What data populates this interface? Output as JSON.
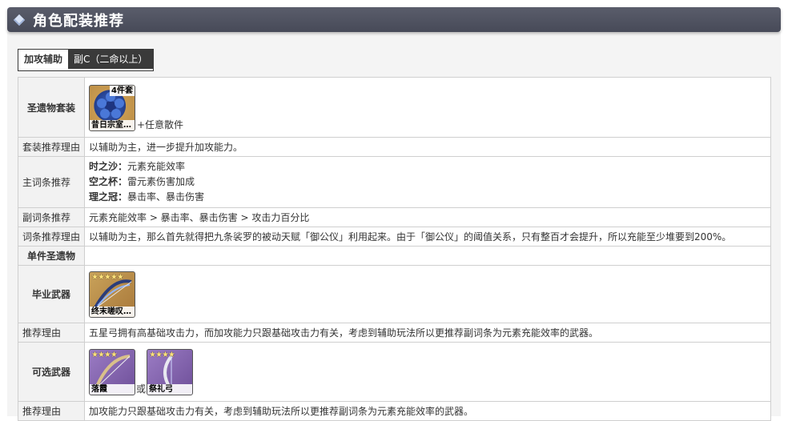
{
  "header": {
    "title": "角色配装推荐"
  },
  "tabs": [
    {
      "label": "加攻辅助",
      "active": true
    },
    {
      "label": "副C（二命以上）",
      "active": false
    }
  ],
  "rows": {
    "artifact_set": {
      "label": "圣遗物套装",
      "item": {
        "badge": "4件套",
        "caption": "昔日宗室…",
        "icon": "flower-artifact-icon"
      },
      "suffix": "+任意散件"
    },
    "set_reason": {
      "label": "套装推荐理由",
      "value": "以辅助为主，进一步提升加攻能力。"
    },
    "main_stats": {
      "label": "主词条推荐",
      "lines": [
        {
          "key": "时之沙：",
          "value": "元素充能效率"
        },
        {
          "key": "空之杯：",
          "value": "雷元素伤害加成"
        },
        {
          "key": "理之冠：",
          "value": "暴击率、暴击伤害"
        }
      ]
    },
    "sub_stats": {
      "label": "副词条推荐",
      "value": "元素充能效率 > 暴击率、暴击伤害 > 攻击力百分比"
    },
    "stat_reason": {
      "label": "词条推荐理由",
      "value": "以辅助为主，那么首先就得把九条裟罗的被动天赋「御公仪」利用起来。由于「御公仪」的阈值关系，只有整百才会提升，所以充能至少堆要到200%。"
    },
    "single_piece": {
      "label": "单件圣遗物",
      "value": ""
    },
    "best_weapon": {
      "label": "毕业武器",
      "item": {
        "stars": "★★★★★",
        "caption": "终末嗟叹…",
        "icon": "bow-weapon-icon"
      }
    },
    "weapon_reason": {
      "label": "推荐理由",
      "value": "五星弓拥有高基础攻击力，而加攻能力只跟基础攻击力有关，考虑到辅助玩法所以更推荐副词条为元素充能效率的武器。"
    },
    "alt_weapons": {
      "label": "可选武器",
      "items": [
        {
          "stars": "★★★★",
          "caption": "落霞",
          "icon": "bow-weapon-icon"
        },
        {
          "stars": "★★★★",
          "caption": "祭礼弓",
          "icon": "bow-weapon-icon"
        }
      ],
      "separator": "或"
    },
    "alt_reason": {
      "label": "推荐理由",
      "value": "加攻能力只跟基础攻击力有关，考虑到辅助玩法所以更推荐副词条为元素充能效率的武器。"
    }
  },
  "colors": {
    "header_bg": "#4f5260",
    "tab_active_bg": "#ffffff",
    "tab_inactive_bg": "#3a3a3a",
    "label_bg": "#f2f2f2",
    "star": "#ffe27a"
  }
}
